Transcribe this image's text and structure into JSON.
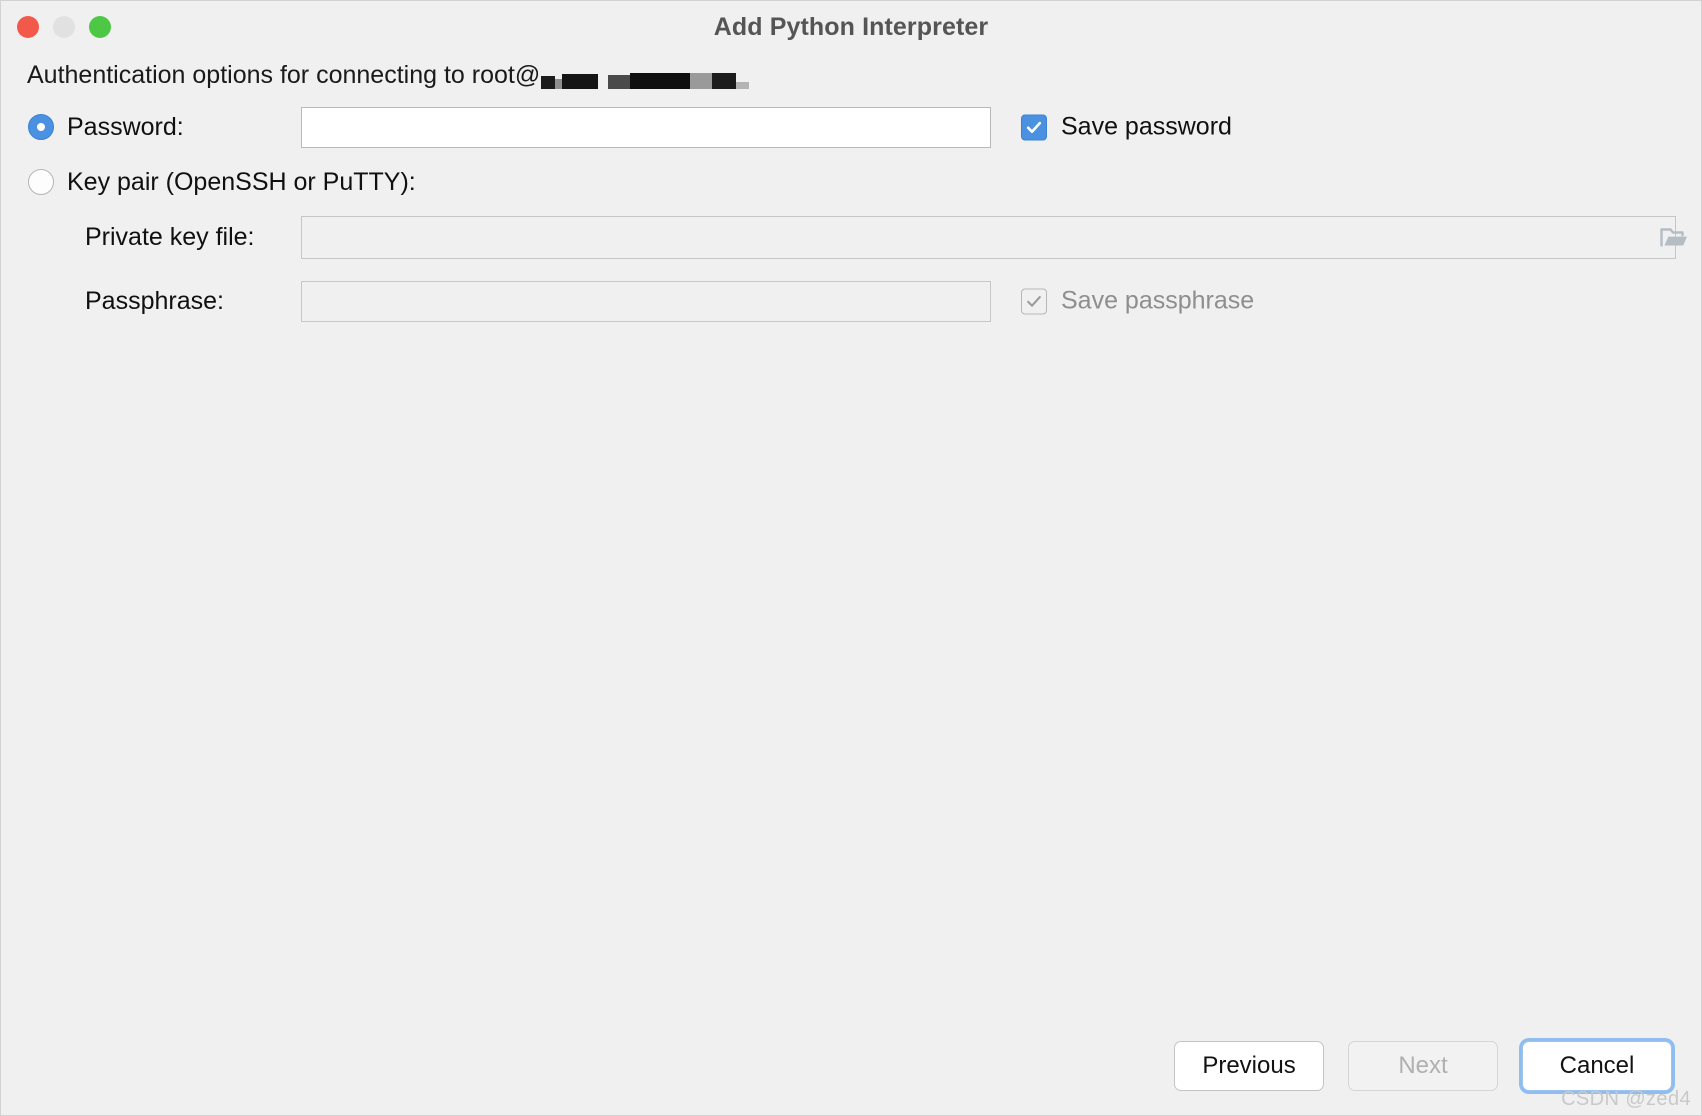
{
  "window": {
    "title": "Add Python Interpreter",
    "traffic_lights": [
      {
        "name": "close",
        "color": "#f2594b"
      },
      {
        "name": "minimize",
        "color": "#e1e1e1"
      },
      {
        "name": "zoom",
        "color": "#4fc746"
      }
    ]
  },
  "subtitle": {
    "prefix": "Authentication options for connecting to root@",
    "host_redacted": true
  },
  "auth": {
    "selected_mode": "password",
    "password": {
      "radio_label": "Password:",
      "radio_selected": true,
      "value": "",
      "placeholder": "",
      "save_label": "Save password",
      "save_checked": true,
      "save_enabled": true
    },
    "keypair": {
      "radio_label": "Key pair (OpenSSH or PuTTY):",
      "radio_selected": false,
      "private_key_label": "Private key file:",
      "private_key_value": "",
      "private_key_placeholder": "",
      "browse_icon": "folder-icon",
      "passphrase_label": "Passphrase:",
      "passphrase_value": "",
      "passphrase_placeholder": "",
      "save_passphrase_label": "Save passphrase",
      "save_passphrase_checked": true,
      "save_passphrase_enabled": false
    }
  },
  "footer": {
    "previous_label": "Previous",
    "next_label": "Next",
    "next_enabled": false,
    "cancel_label": "Cancel",
    "cancel_is_default": true
  },
  "watermark": "CSDN @zed4",
  "colors": {
    "accent": "#4a91e2",
    "window_bg": "#f0f0f0",
    "focus_ring": "#8fbdf0",
    "disabled_text": "#b0b0b0"
  }
}
